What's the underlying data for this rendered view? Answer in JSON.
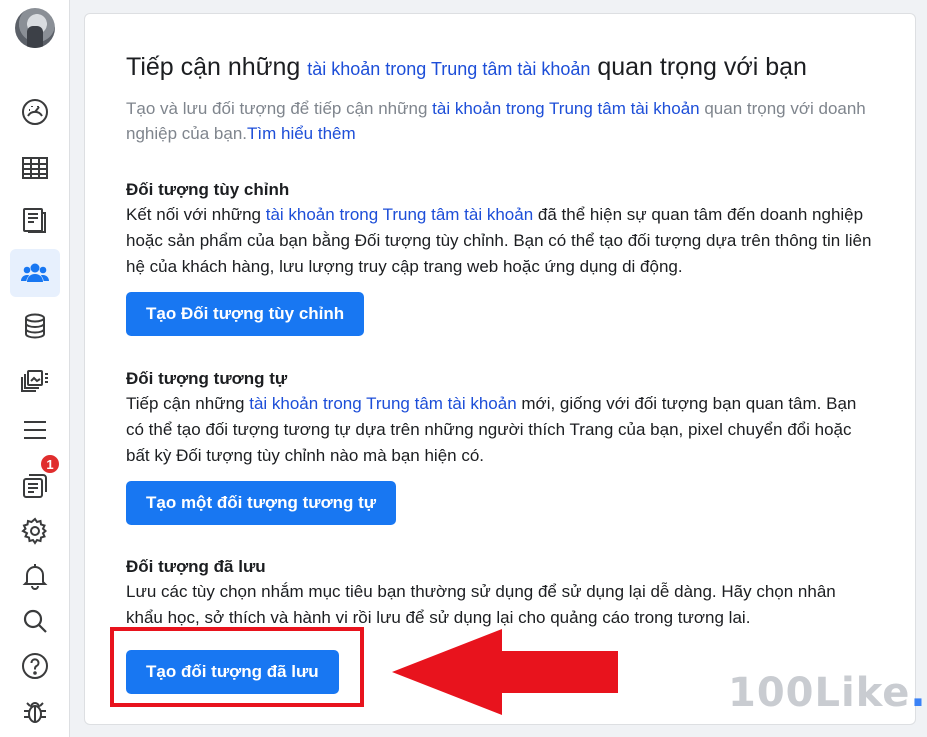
{
  "heading": {
    "prefix": "Tiếp cận những ",
    "link": "tài khoản trong Trung tâm tài khoản",
    "suffix": " quan trọng với bạn"
  },
  "intro": {
    "prefix": "Tạo và lưu đối tượng để tiếp cận những ",
    "link": "tài khoản trong Trung tâm tài khoản",
    "middle": " quan trọng với doanh nghiệp của bạn.",
    "learn_more": "Tìm hiểu thêm"
  },
  "custom": {
    "title": "Đối tượng tùy chỉnh",
    "desc_prefix": "Kết nối với những ",
    "desc_link": "tài khoản trong Trung tâm tài khoản",
    "desc_suffix": " đã thể hiện sự quan tâm đến doanh nghiệp hoặc sản phẩm của bạn bằng Đối tượng tùy chỉnh. Bạn có thể tạo đối tượng dựa trên thông tin liên hệ của khách hàng, lưu lượng truy cập trang web hoặc ứng dụng di động.",
    "button": "Tạo Đối tượng tùy chỉnh"
  },
  "lookalike": {
    "title": "Đối tượng tương tự",
    "desc_prefix": "Tiếp cận những ",
    "desc_link": "tài khoản trong Trung tâm tài khoản",
    "desc_suffix": " mới, giống với đối tượng bạn quan tâm. Bạn có thể tạo đối tượng tương tự dựa trên những người thích Trang của bạn, pixel chuyển đổi hoặc bất kỳ Đối tượng tùy chỉnh nào mà bạn hiện có.",
    "button": "Tạo một đối tượng tương tự"
  },
  "saved": {
    "title": "Đối tượng đã lưu",
    "desc": "Lưu các tùy chọn nhắm mục tiêu bạn thường sử dụng để sử dụng lại dễ dàng. Hãy chọn nhân khẩu học, sở thích và hành vi rồi lưu để sử dụng lại cho quảng cáo trong tương lai.",
    "button": "Tạo đối tượng đã lưu"
  },
  "sidebar": {
    "badge_count": "1",
    "icons": [
      "dashboard-icon",
      "table-icon",
      "pages-icon",
      "audience-icon",
      "database-icon",
      "media-library-icon",
      "menu-icon",
      "notifications-icon",
      "settings-icon",
      "bell-icon",
      "search-icon",
      "help-icon",
      "bug-icon"
    ]
  },
  "watermark": {
    "text": "100Like",
    "dot": "."
  },
  "colors": {
    "primary": "#1877f2",
    "link": "#1d4ed8",
    "highlight": "#e8131d",
    "badge": "#e02d2d"
  }
}
